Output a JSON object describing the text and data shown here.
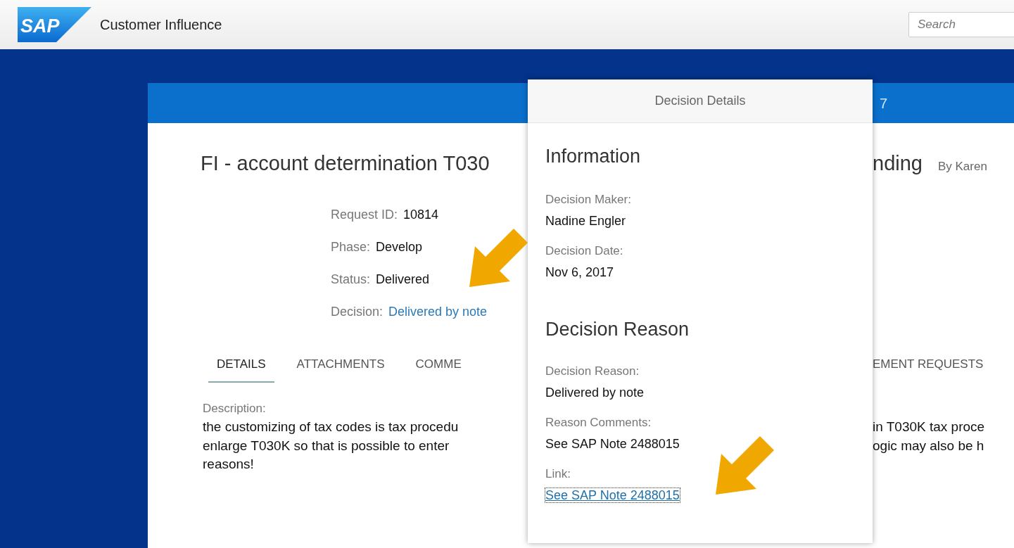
{
  "header": {
    "logo_text": "SAP",
    "app_title": "Customer Influence",
    "search": {
      "placeholder": "Search"
    }
  },
  "request": {
    "band_fragment": "7",
    "title_left_part": "FI - account determination T030",
    "title_right_part": "nding",
    "author": "By Karen",
    "fields": [
      {
        "label": "Request ID:",
        "value": "10814",
        "kind": "text"
      },
      {
        "label": "Phase:",
        "value": "Develop",
        "kind": "text"
      },
      {
        "label": "Status:",
        "value": "Delivered",
        "kind": "text"
      },
      {
        "label": "Decision:",
        "value": "Delivered by note",
        "kind": "link"
      }
    ],
    "tabs": [
      {
        "label": "DETAILS",
        "selected": true
      },
      {
        "label": "ATTACHMENTS",
        "selected": false
      },
      {
        "label": "COMME",
        "selected": false
      },
      {
        "label": "EMENT REQUESTS",
        "selected": false
      }
    ],
    "description": {
      "label": "Description:",
      "lines": [
        {
          "left_part": "the customizing of tax codes is tax procedu",
          "right_part": "in T030K tax proce"
        },
        {
          "left_part": "enlarge T030K so that is possible to enter",
          "right_part": "ogic may also be h"
        },
        {
          "left_part": "reasons!"
        }
      ]
    }
  },
  "popover": {
    "title": "Decision Details",
    "sections": [
      {
        "title": "Information",
        "items": [
          {
            "label": "Decision Maker:",
            "value": "Nadine Engler",
            "kind": "text"
          },
          {
            "label": "Decision Date:",
            "value": "Nov 6, 2017",
            "kind": "text"
          }
        ]
      },
      {
        "title": "Decision Reason",
        "items": [
          {
            "label": "Decision Reason:",
            "value": "Delivered by note",
            "kind": "text"
          },
          {
            "label": "Reason Comments:",
            "value": "See SAP Note 2488015",
            "kind": "text"
          },
          {
            "label": "Link:",
            "value": "See SAP Note 2488015",
            "kind": "link"
          }
        ]
      }
    ]
  }
}
